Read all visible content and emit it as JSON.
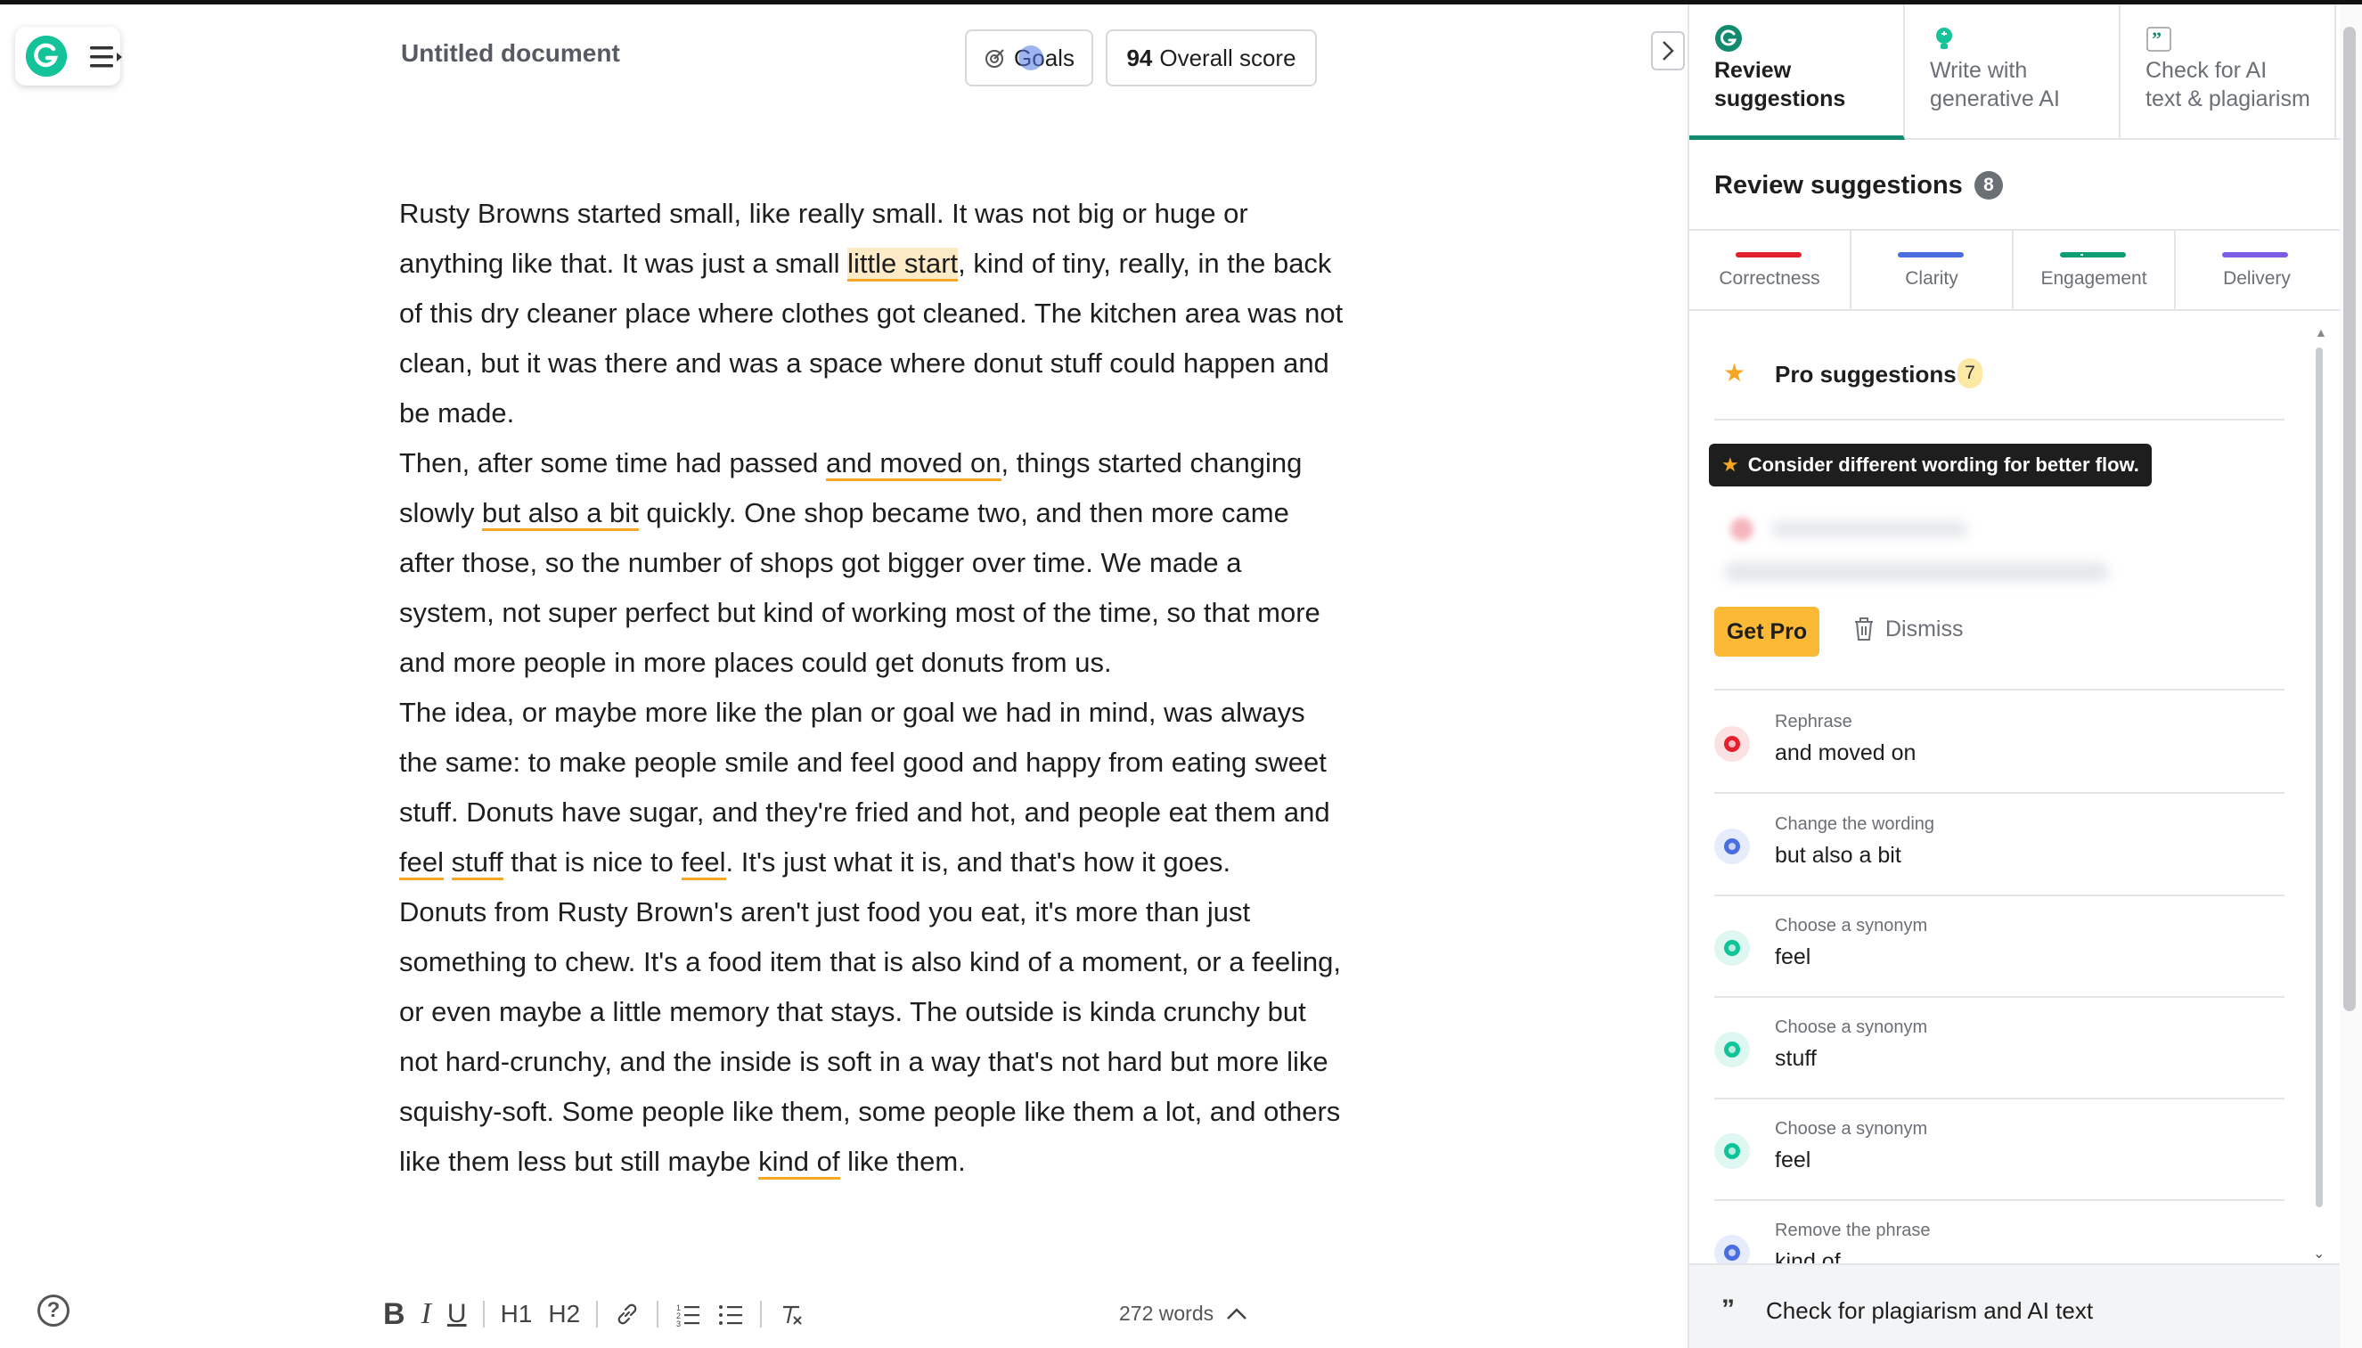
{
  "document": {
    "title": "Untitled document",
    "goals_label": "Goals",
    "score_value": "94",
    "score_label": "Overall score",
    "paragraphs": [
      [
        {
          "t": "Rusty Browns started small, like really small. It was not big or huge or anything like that. It was just a small "
        },
        {
          "t": "little start",
          "hl": "focus"
        },
        {
          "t": ", kind of tiny, really, in the back of this dry cleaner place where clothes got cleaned. The kitchen area was not clean, but it was there and was a space where donut stuff could happen and be made."
        }
      ],
      [
        {
          "t": "Then, after some time had passed "
        },
        {
          "t": "and moved on",
          "hl": "under"
        },
        {
          "t": ", things started changing slowly "
        },
        {
          "t": "but also a bit",
          "hl": "under"
        },
        {
          "t": " quickly. One shop became two, and then more came after those, so the number of shops got bigger over time. We made a system, not super perfect but kind of working most of the time, so that more and more people in more places could get donuts from us."
        }
      ],
      [
        {
          "t": "The idea, or maybe more like the plan or goal we had in mind, was always the same: to make people smile and feel good and happy from eating sweet stuff. Donuts have sugar, and they're fried and hot, and people eat them and "
        },
        {
          "t": "feel",
          "hl": "under"
        },
        {
          "t": " "
        },
        {
          "t": "stuff",
          "hl": "under"
        },
        {
          "t": " that is nice to "
        },
        {
          "t": "feel",
          "hl": "under"
        },
        {
          "t": ". It's just what it is, and that's how it goes."
        }
      ],
      [
        {
          "t": "Donuts from Rusty Brown's aren't just food you eat, it's more than just something to chew. It's a food item that is also kind of a moment, or a feeling, or even maybe a little memory that stays. The outside is kinda crunchy but not hard-crunchy, and the inside is soft in a way that's not hard but more like squishy-soft. Some people like them, some people like them a lot, and others like them less but still maybe "
        },
        {
          "t": "kind of",
          "hl": "under"
        },
        {
          "t": " like them."
        }
      ]
    ],
    "word_count": "272 words"
  },
  "toolbar": {
    "bold": "B",
    "italic": "I",
    "underline": "U",
    "h1": "H1",
    "h2": "H2",
    "icons": [
      "bold-icon",
      "italic-icon",
      "underline-icon",
      "heading1-icon",
      "heading2-icon",
      "link-icon",
      "numbered-list-icon",
      "bulleted-list-icon",
      "clear-formatting-icon"
    ]
  },
  "help": {
    "label": "?"
  },
  "sidebar": {
    "tabs": [
      {
        "line1": "Review",
        "line2": "suggestions",
        "icon": "grammarly-logo-icon",
        "active": true
      },
      {
        "line1": "Write with",
        "line2": "generative AI",
        "icon": "lightbulb-icon",
        "active": false
      },
      {
        "line1": "Check for AI",
        "line2": "text & plagiarism",
        "icon": "quote-icon",
        "active": false
      }
    ],
    "header": "Review suggestions",
    "header_count": "8",
    "categories": [
      {
        "label": "Correctness",
        "color": "#e5202e"
      },
      {
        "label": "Clarity",
        "color": "#4a6ee0"
      },
      {
        "label": "Engagement",
        "color": "#0f9d74"
      },
      {
        "label": "Delivery",
        "color": "#7d5ce6"
      }
    ],
    "pro": {
      "label": "Pro suggestions",
      "count": "7"
    },
    "tip": "Consider different wording for better flow.",
    "get_pro": "Get Pro",
    "dismiss": "Dismiss",
    "suggestions": [
      {
        "kind": "Rephrase",
        "text": "and moved on",
        "icon": "correctness-shield-icon",
        "color": "#e5202e"
      },
      {
        "kind": "Change the wording",
        "text": "but also a bit",
        "icon": "clarity-icon",
        "color": "#4a6ee0"
      },
      {
        "kind": "Choose a synonym",
        "text": "feel",
        "icon": "engagement-icon",
        "color": "#0fc598"
      },
      {
        "kind": "Choose a synonym",
        "text": "stuff",
        "icon": "engagement-icon",
        "color": "#0fc598"
      },
      {
        "kind": "Choose a synonym",
        "text": "feel",
        "icon": "engagement-icon",
        "color": "#0fc598"
      },
      {
        "kind": "Remove the phrase",
        "text": "kind of",
        "icon": "clarity-icon",
        "color": "#4a6ee0"
      }
    ],
    "footer": "Check for plagiarism and AI text",
    "footer_icon": "quote-icon"
  },
  "colors": {
    "brand": "#15c39a",
    "highlight_underline": "#f5a623",
    "highlight_fill": "#fdebc8",
    "get_pro": "#fbb936"
  }
}
